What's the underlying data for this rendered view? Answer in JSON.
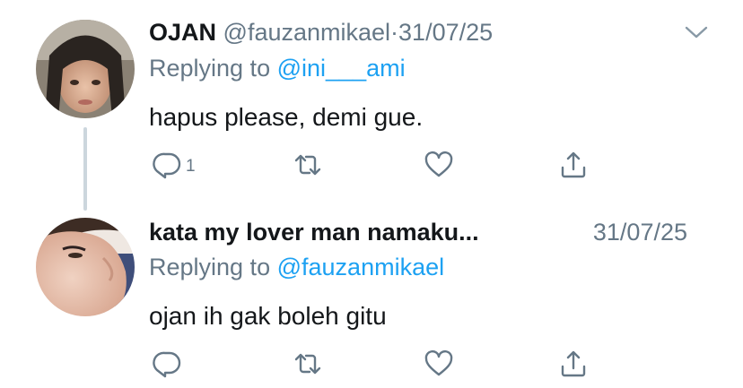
{
  "tweets": [
    {
      "name": "OJAN",
      "handle": "@fauzanmikael",
      "separator": "·",
      "date": "31/07/25",
      "replying_prefix": "Replying to",
      "replying_to": "@ini___ami",
      "text": "hapus please, demi gue.",
      "reply_count": "1",
      "icons": [
        "reply-icon",
        "retweet-icon",
        "like-icon",
        "share-icon",
        "chevron-down-icon"
      ]
    },
    {
      "name": "kata my lover man namaku...",
      "date": "31/07/25",
      "replying_prefix": "Replying to",
      "replying_to": "@fauzanmikael",
      "text": "ojan ih gak boleh gitu",
      "icons": [
        "reply-icon",
        "retweet-icon",
        "like-icon",
        "share-icon"
      ]
    }
  ],
  "colors": {
    "link": "#1da1f2",
    "secondary_text": "#657786",
    "primary_text": "#14171a",
    "thread_line": "#ccd6dd"
  }
}
